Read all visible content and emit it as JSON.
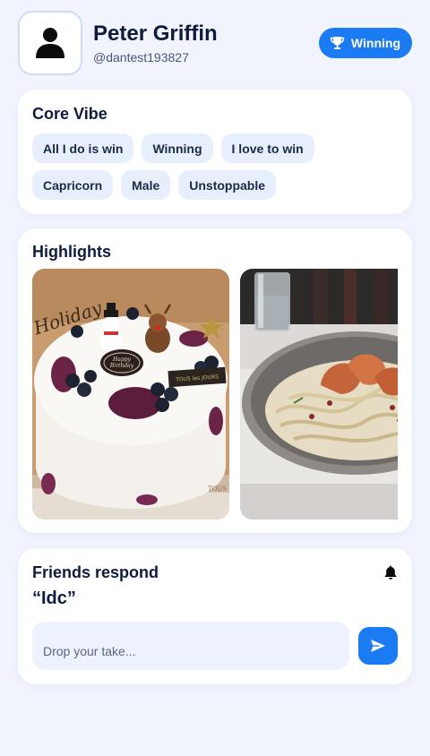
{
  "profile": {
    "name": "Peter Griffin",
    "handle": "@dantest193827",
    "avatar_icon": "person-icon",
    "status_label": "Winning",
    "status_icon": "trophy-icon"
  },
  "core_vibe": {
    "title": "Core Vibe",
    "tags": [
      "All I do is win",
      "Winning",
      "I love to win",
      "Capricorn",
      "Male",
      "Unstoppable"
    ]
  },
  "highlights": {
    "title": "Highlights",
    "photos": [
      {
        "subject": "decorated holiday cake with blueberries",
        "text": [
          "Holiday",
          "Happy Birthday",
          "TOUS les JOURS",
          "TOUS"
        ]
      },
      {
        "subject": "shrimp pasta in a metal bowl with a glass of water"
      }
    ]
  },
  "friends": {
    "title": "Friends respond",
    "bell_icon": "bell-icon",
    "quote": "“Idc”",
    "input_placeholder": "Drop your take...",
    "send_icon": "send-icon"
  },
  "colors": {
    "accent": "#1a7bf2",
    "background": "#f1f4fd",
    "tag_background": "#e7eefc",
    "text_primary": "#0f1b3d"
  }
}
